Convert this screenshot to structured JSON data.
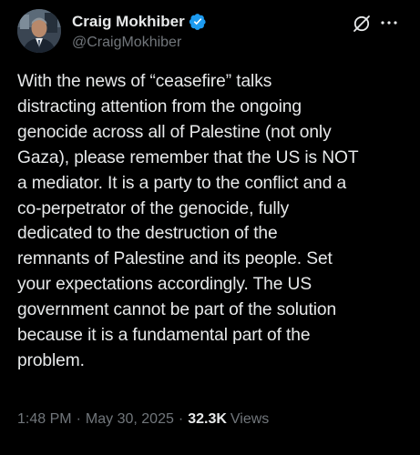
{
  "author": {
    "display_name": "Craig Mokhiber",
    "handle": "@CraigMokhiber",
    "verified": true
  },
  "icons": {
    "verified": "verified-badge-icon",
    "grok": "grok-slash-icon",
    "more": "more-ellipsis-icon"
  },
  "post": {
    "text": "With the news of “ceasefire” talks\ndistracting attention from the ongoing\ngenocide across all of Palestine (not only\nGaza), please remember that the US is NOT\na mediator. It is a party to the conflict and a\nco-perpetrator of the genocide, fully\ndedicated to the destruction of the\nremnants of Palestine and its people. Set\nyour expectations accordingly. The US\ngovernment cannot be part of the solution\nbecause it is a fundamental part of the\nproblem."
  },
  "meta": {
    "time": "1:48 PM",
    "separator": "·",
    "date": "May 30, 2025",
    "views_count": "32.3K",
    "views_label": "Views"
  },
  "colors": {
    "background": "#000000",
    "text": "#e7e9ea",
    "secondary": "#71767b",
    "verified": "#1d9bf0"
  }
}
